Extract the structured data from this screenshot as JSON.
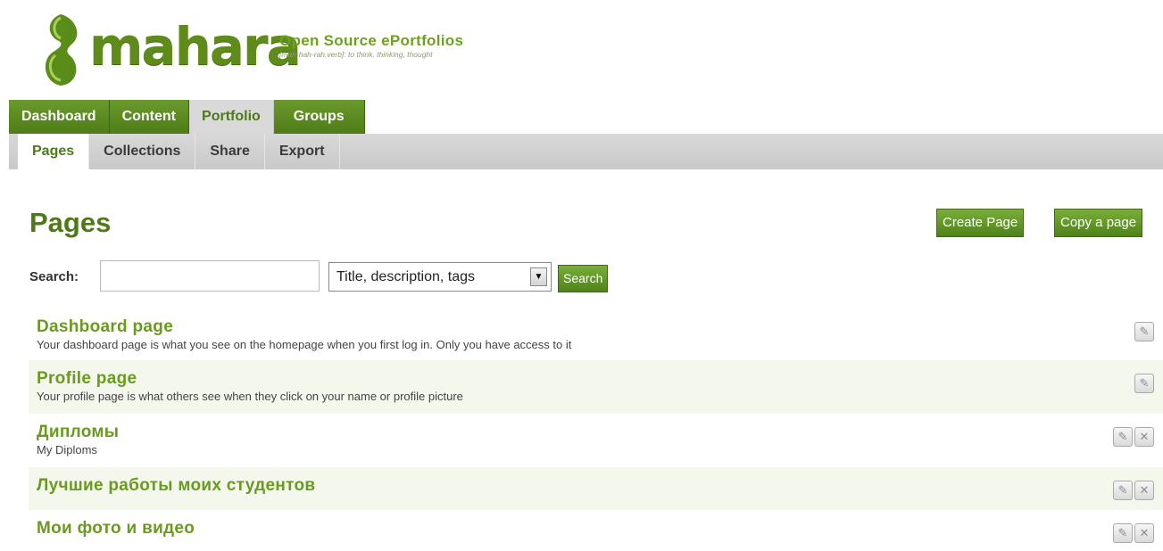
{
  "header": {
    "logo_text": "mahara",
    "tagline": "Open Source ePortfolios",
    "tagline_sub": "[mah-hah-rah,verb]: to think, thinking, thought"
  },
  "main_nav": [
    {
      "label": "Dashboard",
      "active": false
    },
    {
      "label": "Content",
      "active": false
    },
    {
      "label": "Portfolio",
      "active": true
    },
    {
      "label": "Groups",
      "active": false
    }
  ],
  "sub_nav": [
    {
      "label": "Pages",
      "active": true
    },
    {
      "label": "Collections",
      "active": false
    },
    {
      "label": "Share",
      "active": false
    },
    {
      "label": "Export",
      "active": false
    }
  ],
  "page": {
    "title": "Pages",
    "create_label": "Create Page",
    "copy_label": "Copy a page"
  },
  "search": {
    "label": "Search:",
    "value": "",
    "scope": "Title, description, tags",
    "button_label": "Search"
  },
  "pages": [
    {
      "title": "Dashboard page",
      "description": "Your dashboard page is what you see on the homepage when you first log in. Only you have access to it",
      "edit": true,
      "delete": false
    },
    {
      "title": "Profile page",
      "description": "Your profile page is what others see when they click on your name or profile picture",
      "edit": true,
      "delete": false
    },
    {
      "title": "Дипломы",
      "description": "My Diploms",
      "edit": true,
      "delete": true
    },
    {
      "title": "Лучшие работы моих студентов",
      "description": "",
      "edit": true,
      "delete": true
    },
    {
      "title": "Мои фото и видео",
      "description": "",
      "edit": true,
      "delete": true
    }
  ],
  "colors": {
    "brand_green": "#4d7a17",
    "link_green": "#6a9a1f",
    "nav_green": "#5a8a22"
  },
  "icons": {
    "edit": "pencil-icon",
    "delete": "close-icon"
  }
}
